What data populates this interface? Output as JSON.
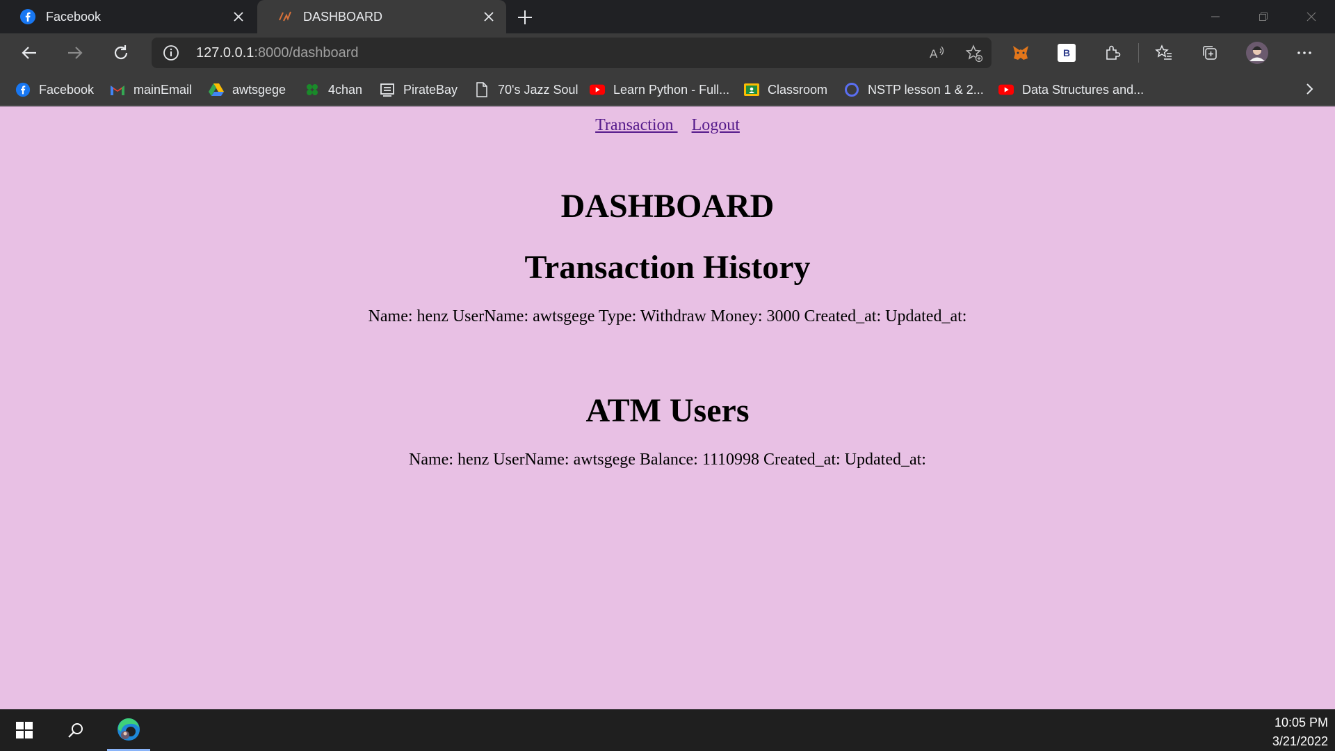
{
  "browser": {
    "tabs": [
      {
        "title": "Facebook",
        "icon": "facebook-icon",
        "active": false
      },
      {
        "title": "DASHBOARD",
        "icon": "django-icon",
        "active": true
      }
    ],
    "url_host": "127.0.0.1",
    "url_rest": ":8000/dashboard",
    "bookmarks": [
      {
        "label": "Facebook",
        "icon": "facebook-icon"
      },
      {
        "label": "mainEmail",
        "icon": "gmail-icon"
      },
      {
        "label": "awtsgege",
        "icon": "google-drive-icon"
      },
      {
        "label": "4chan",
        "icon": "clover-icon"
      },
      {
        "label": "PirateBay",
        "icon": "pirate-icon"
      },
      {
        "label": "70's Jazz Soul",
        "icon": "page-icon"
      },
      {
        "label": "Learn Python - Full...",
        "icon": "youtube-icon"
      },
      {
        "label": "Classroom",
        "icon": "classroom-icon"
      },
      {
        "label": "NSTP lesson 1 & 2...",
        "icon": "circle-icon"
      },
      {
        "label": "Data Structures and...",
        "icon": "youtube-icon"
      }
    ],
    "extension_badge": "B"
  },
  "page": {
    "nav": {
      "transaction": "Transaction ",
      "logout": "Logout"
    },
    "title": "DASHBOARD",
    "transaction_heading": "Transaction History",
    "transaction_line": "Name: henz UserName: awtsgege Type: Withdraw Money: 3000 Created_at: Updated_at:",
    "users_heading": "ATM Users",
    "users_line": "Name: henz UserName: awtsgege Balance: 1110998 Created_at: Updated_at:"
  },
  "taskbar": {
    "time": "10:05 PM",
    "date": "3/21/2022"
  },
  "colors": {
    "page_bg": "#e8c0e4",
    "link": "#551a8b",
    "chrome_dark": "#202124",
    "chrome_toolbar": "#3b3b3b"
  }
}
